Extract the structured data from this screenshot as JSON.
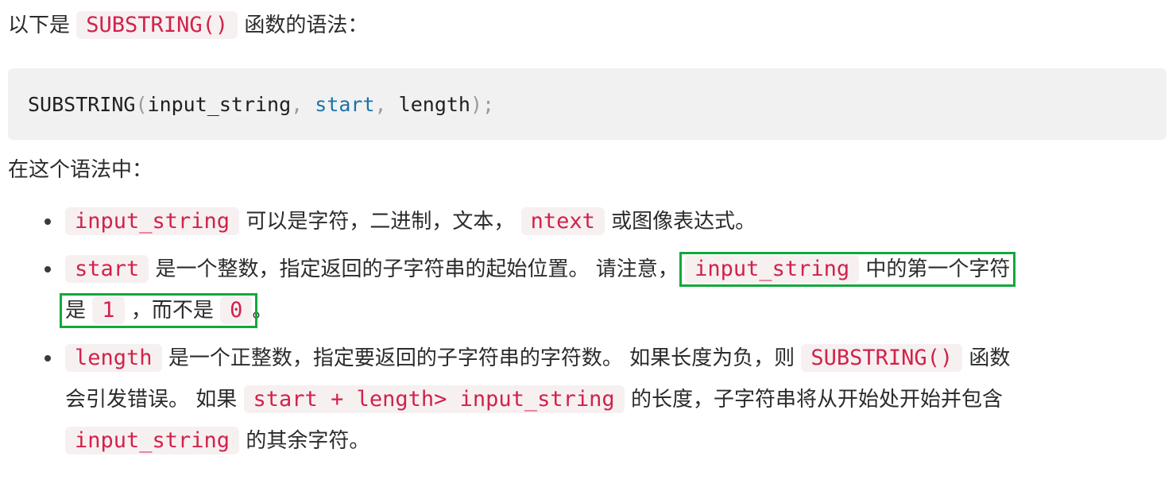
{
  "intro": {
    "prefix": "以下是",
    "func": "SUBSTRING()",
    "suffix": "函数的语法："
  },
  "code_block": {
    "fn": "SUBSTRING",
    "open": "(",
    "arg1": "input_string",
    "comma1": ",",
    "arg2": "start",
    "comma2": ",",
    "arg3": "length",
    "close": ");"
  },
  "syntax_caption": "在这个语法中：",
  "bullets": [
    {
      "code1": "input_string",
      "text1": "可以是字符，二进制，文本，",
      "code2": "ntext",
      "text2": "或图像表达式。"
    },
    {
      "code1": "start",
      "text1": "是一个整数，指定返回的子字符串的起始位置。 请注意，",
      "code2": "input_string",
      "text2": "中的第一个字符",
      "text3": "是",
      "code3": "1",
      "text4": "，而不是",
      "code4": "0",
      "text5": "。"
    },
    {
      "code1": "length",
      "text1": "是一个正整数，指定要返回的子字符串的字符数。 如果长度为负，则",
      "code2": "SUBSTRING()",
      "text2": "函数",
      "text3": "会引发错误。 如果",
      "code3": "start + length> input_string",
      "text4": "的长度，子字符串将从开始处开始并包含",
      "code4": "input_string",
      "text5": "的其余字符。"
    }
  ],
  "colors": {
    "inline_code": "#d1224a",
    "inline_code_bg": "#f6f0f1",
    "code_block_bg": "#f2f1f1",
    "highlight_box": "#14a83c",
    "keyword": "#1a73a8"
  }
}
